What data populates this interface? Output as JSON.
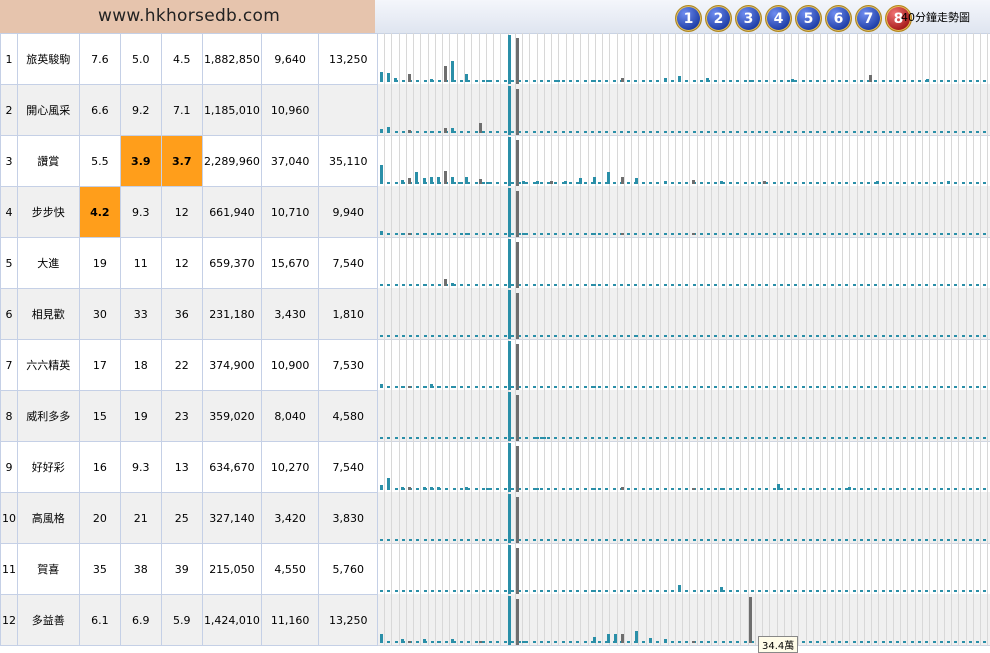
{
  "site_title": "www.hkhorsedb.com",
  "race_buttons": [
    "1",
    "2",
    "3",
    "4",
    "5",
    "6",
    "7",
    "8"
  ],
  "active_race": "8",
  "trend_label": "40分鐘走勢圖",
  "tooltip": "34.4萬",
  "colors": {
    "highlight": "#ff9e1b",
    "bar_teal": "#2a8fa8",
    "bar_gray": "#6e6e6e"
  },
  "horses": [
    {
      "no": "1",
      "name": "旅英駿駒",
      "o1": "7.6",
      "o2": "5.0",
      "o3": "4.5",
      "v1": "1,882,850",
      "v2": "9,640",
      "v3": "13,250",
      "hl": []
    },
    {
      "no": "2",
      "name": "開心風采",
      "o1": "6.6",
      "o2": "9.2",
      "o3": "7.1",
      "v1": "1,185,010",
      "v2": "10,960",
      "v3": "",
      "hl": []
    },
    {
      "no": "3",
      "name": "讚賞",
      "o1": "5.5",
      "o2": "3.9",
      "o3": "3.7",
      "v1": "2,289,960",
      "v2": "37,040",
      "v3": "35,110",
      "hl": [
        "o2",
        "o3"
      ]
    },
    {
      "no": "4",
      "name": "步步快",
      "o1": "4.2",
      "o2": "9.3",
      "o3": "12",
      "v1": "661,940",
      "v2": "10,710",
      "v3": "9,940",
      "hl": [
        "o1"
      ]
    },
    {
      "no": "5",
      "name": "大進",
      "o1": "19",
      "o2": "11",
      "o3": "12",
      "v1": "659,370",
      "v2": "15,670",
      "v3": "7,540",
      "hl": []
    },
    {
      "no": "6",
      "name": "相見歡",
      "o1": "30",
      "o2": "33",
      "o3": "36",
      "v1": "231,180",
      "v2": "3,430",
      "v3": "1,810",
      "hl": []
    },
    {
      "no": "7",
      "name": "六六精英",
      "o1": "17",
      "o2": "18",
      "o3": "22",
      "v1": "374,900",
      "v2": "10,900",
      "v3": "7,530",
      "hl": []
    },
    {
      "no": "8",
      "name": "威利多多",
      "o1": "15",
      "o2": "19",
      "o3": "23",
      "v1": "359,020",
      "v2": "8,040",
      "v3": "4,580",
      "hl": []
    },
    {
      "no": "9",
      "name": "好好彩",
      "o1": "16",
      "o2": "9.3",
      "o3": "13",
      "v1": "634,670",
      "v2": "10,270",
      "v3": "7,540",
      "hl": []
    },
    {
      "no": "10",
      "name": "高風格",
      "o1": "20",
      "o2": "21",
      "o3": "25",
      "v1": "327,140",
      "v2": "3,420",
      "v3": "3,830",
      "hl": []
    },
    {
      "no": "11",
      "name": "賀喜",
      "o1": "35",
      "o2": "38",
      "o3": "39",
      "v1": "215,050",
      "v2": "4,550",
      "v3": "5,760",
      "hl": []
    },
    {
      "no": "12",
      "name": "多益善",
      "o1": "6.1",
      "o2": "6.9",
      "o3": "5.9",
      "v1": "1,424,010",
      "v2": "11,160",
      "v3": "13,250",
      "hl": []
    }
  ],
  "chart_data": {
    "type": "bar",
    "title": "40分鐘走勢圖",
    "series": [
      {
        "tall": [
          6,
          5
        ],
        "spikes": [
          [
            0,
            0.22
          ],
          [
            1,
            0.2
          ],
          [
            2,
            0.08
          ],
          [
            4,
            0.18
          ],
          [
            7,
            0.06
          ],
          [
            9,
            0.34
          ],
          [
            10,
            0.45
          ],
          [
            12,
            0.18
          ],
          [
            15,
            0.05
          ],
          [
            18,
            0.08
          ],
          [
            25,
            0.05
          ],
          [
            30,
            0.05
          ],
          [
            34,
            0.08
          ],
          [
            38,
            0.05
          ],
          [
            40,
            0.08
          ],
          [
            42,
            0.12
          ],
          [
            46,
            0.08
          ],
          [
            52,
            0.05
          ],
          [
            58,
            0.06
          ],
          [
            69,
            0.16
          ],
          [
            77,
            0.06
          ]
        ]
      },
      {
        "tall": [
          6,
          5
        ],
        "spikes": [
          [
            0,
            0.08
          ],
          [
            1,
            0.12
          ],
          [
            4,
            0.06
          ],
          [
            7,
            0.05
          ],
          [
            9,
            0.1
          ],
          [
            10,
            0.1
          ],
          [
            14,
            0.22
          ]
        ]
      },
      {
        "tall": [
          6,
          5
        ],
        "spikes": [
          [
            0,
            0.42
          ],
          [
            3,
            0.08
          ],
          [
            4,
            0.12
          ],
          [
            5,
            0.25
          ],
          [
            6,
            0.12
          ],
          [
            7,
            0.15
          ],
          [
            8,
            0.15
          ],
          [
            9,
            0.28
          ],
          [
            10,
            0.15
          ],
          [
            11,
            0.05
          ],
          [
            12,
            0.15
          ],
          [
            14,
            0.1
          ],
          [
            15,
            0.05
          ],
          [
            18,
            0.06
          ],
          [
            20,
            0.06
          ],
          [
            22,
            0.06
          ],
          [
            24,
            0.06
          ],
          [
            26,
            0.06
          ],
          [
            28,
            0.12
          ],
          [
            30,
            0.15
          ],
          [
            32,
            0.25
          ],
          [
            34,
            0.15
          ],
          [
            36,
            0.12
          ],
          [
            40,
            0.06
          ],
          [
            44,
            0.08
          ],
          [
            48,
            0.06
          ],
          [
            54,
            0.06
          ],
          [
            70,
            0.06
          ],
          [
            80,
            0.06
          ]
        ]
      },
      {
        "tall": [
          6,
          5
        ],
        "spikes": [
          [
            0,
            0.08
          ],
          [
            3,
            0.05
          ],
          [
            4,
            0.05
          ],
          [
            6,
            0.05
          ],
          [
            8,
            0.05
          ],
          [
            12,
            0.05
          ],
          [
            20,
            0.05
          ],
          [
            30,
            0.05
          ],
          [
            34,
            0.05
          ],
          [
            44,
            0.05
          ]
        ]
      },
      {
        "tall": [
          6,
          5
        ],
        "spikes": [
          [
            0,
            0.05
          ],
          [
            6,
            0.05
          ],
          [
            9,
            0.15
          ],
          [
            10,
            0.06
          ],
          [
            30,
            0.05
          ]
        ]
      },
      {
        "tall": [
          6,
          5
        ],
        "spikes": [
          [
            36,
            0.05
          ]
        ]
      },
      {
        "tall": [
          6,
          5
        ],
        "spikes": [
          [
            0,
            0.08
          ],
          [
            3,
            0.05
          ],
          [
            4,
            0.05
          ],
          [
            6,
            0.05
          ],
          [
            7,
            0.08
          ],
          [
            8,
            0.05
          ],
          [
            10,
            0.05
          ],
          [
            30,
            0.05
          ]
        ]
      },
      {
        "tall": [
          6,
          5
        ],
        "spikes": [
          [
            22,
            0.05
          ],
          [
            23,
            0.05
          ]
        ]
      },
      {
        "tall": [
          6,
          5
        ],
        "spikes": [
          [
            0,
            0.1
          ],
          [
            1,
            0.25
          ],
          [
            3,
            0.06
          ],
          [
            4,
            0.06
          ],
          [
            6,
            0.06
          ],
          [
            7,
            0.06
          ],
          [
            8,
            0.06
          ],
          [
            12,
            0.06
          ],
          [
            15,
            0.05
          ],
          [
            22,
            0.05
          ],
          [
            30,
            0.05
          ],
          [
            34,
            0.06
          ],
          [
            44,
            0.05
          ],
          [
            48,
            0.05
          ],
          [
            56,
            0.12
          ],
          [
            66,
            0.06
          ]
        ]
      },
      {
        "tall": [
          6,
          5
        ],
        "spikes": []
      },
      {
        "tall": [
          6,
          5
        ],
        "spikes": [
          [
            30,
            0.05
          ],
          [
            42,
            0.15
          ],
          [
            48,
            0.1
          ]
        ]
      },
      {
        "tall": [
          6,
          5
        ],
        "spikes": [
          [
            0,
            0.2
          ],
          [
            3,
            0.08
          ],
          [
            4,
            0.05
          ],
          [
            6,
            0.08
          ],
          [
            8,
            0.05
          ],
          [
            10,
            0.08
          ],
          [
            14,
            0.05
          ],
          [
            20,
            0.05
          ],
          [
            30,
            0.12
          ],
          [
            32,
            0.2
          ],
          [
            33,
            0.2
          ],
          [
            34,
            0.2
          ],
          [
            36,
            0.25
          ],
          [
            38,
            0.1
          ],
          [
            40,
            0.08
          ],
          [
            44,
            0.05
          ],
          [
            52,
            1.0
          ]
        ]
      }
    ]
  }
}
